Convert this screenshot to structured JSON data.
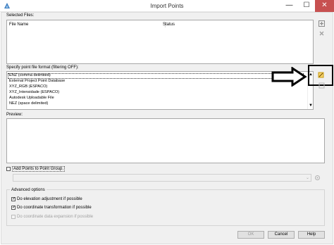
{
  "window": {
    "title": "Import Points",
    "minimize": "—",
    "maximize": "☐",
    "close": "✕"
  },
  "selected_files": {
    "label": "Selected Files:",
    "columns": [
      "File Name",
      "Status"
    ]
  },
  "format": {
    "label": "Specify point file format (filtering OFF):",
    "items": [
      "ENZ (comma delimited)",
      "External Project Point Database",
      "XYZ_RGB (ESPACO)",
      "XYZ_Intensidade (ESPACO)",
      "Autodesk Uploadable File",
      "NEZ (space delimited)"
    ],
    "selected_index": 0
  },
  "preview": {
    "label": "Preview:"
  },
  "point_group": {
    "label": "Add Points to Point Group.",
    "checked": false
  },
  "advanced": {
    "label": "Advanced options",
    "options": [
      {
        "label": "Do elevation adjustment if possible",
        "checked": true,
        "enabled": true
      },
      {
        "label": "Do coordinate transformation if possible",
        "checked": true,
        "enabled": true
      },
      {
        "label": "Do coordinate data expansion if possible",
        "checked": false,
        "enabled": false
      }
    ]
  },
  "buttons": {
    "ok": "OK",
    "cancel": "Cancel",
    "help": "Help"
  },
  "colors": {
    "annotation": "#000000",
    "accent": "#f0b400"
  }
}
